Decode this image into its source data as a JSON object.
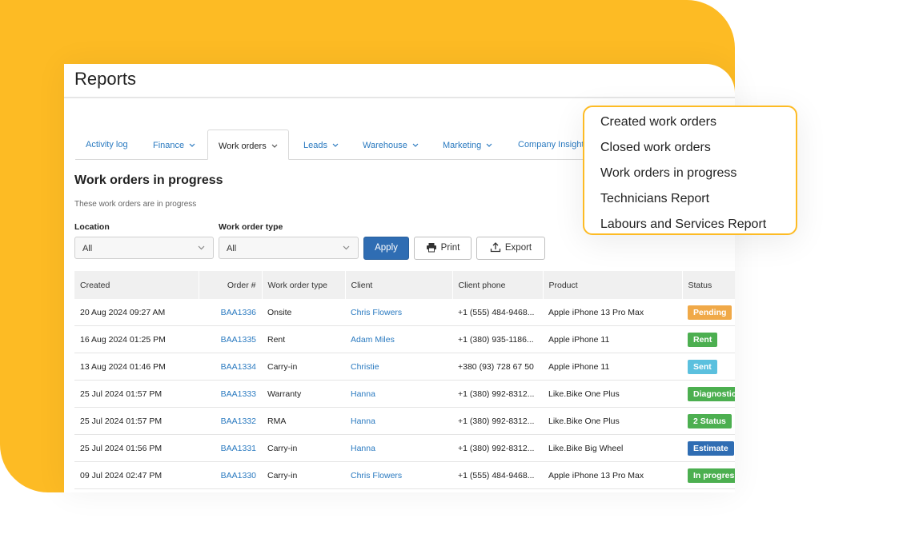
{
  "page": {
    "title": "Reports"
  },
  "tabs": [
    {
      "label": "Activity log",
      "has_chevron": false
    },
    {
      "label": "Finance",
      "has_chevron": true
    },
    {
      "label": "Work orders",
      "has_chevron": true,
      "active": true
    },
    {
      "label": "Leads",
      "has_chevron": true
    },
    {
      "label": "Warehouse",
      "has_chevron": true
    },
    {
      "label": "Marketing",
      "has_chevron": true
    },
    {
      "label": "Company Insight",
      "has_chevron": false
    }
  ],
  "section": {
    "title": "Work orders in progress",
    "subtitle": "These work orders are in progress"
  },
  "filters": {
    "location": {
      "label": "Location",
      "value": "All"
    },
    "type": {
      "label": "Work order type",
      "value": "All"
    }
  },
  "buttons": {
    "apply": "Apply",
    "print": "Print",
    "export": "Export"
  },
  "table": {
    "headers": [
      "Created",
      "Order #",
      "Work order type",
      "Client",
      "Client phone",
      "Product",
      "Status"
    ],
    "rows": [
      {
        "created": "20 Aug 2024 09:27 AM",
        "order": "BAA1336",
        "type": "Onsite",
        "client": "Chris Flowers",
        "phone": "+1 (555) 484-9468...",
        "product": "Apple iPhone 13 Pro Max",
        "status": "Pending",
        "status_color": "#f0a948"
      },
      {
        "created": "16 Aug 2024 01:25 PM",
        "order": "BAA1335",
        "type": "Rent",
        "client": "Adam Miles",
        "phone": "+1 (380) 935-1186...",
        "product": "Apple iPhone 11",
        "status": "Rent",
        "status_color": "#4caf50"
      },
      {
        "created": "13 Aug 2024 01:46 PM",
        "order": "BAA1334",
        "type": "Carry-in",
        "client": "Christie",
        "phone": "+380 (93) 728 67 50",
        "product": "Apple iPhone 11",
        "status": "Sent",
        "status_color": "#5bc0de"
      },
      {
        "created": "25 Jul 2024 01:57 PM",
        "order": "BAA1333",
        "type": "Warranty",
        "client": "Hanna",
        "phone": "+1 (380) 992-8312...",
        "product": "Like.Bike One Plus",
        "status": "Diagnostic",
        "status_color": "#4caf50"
      },
      {
        "created": "25 Jul 2024 01:57 PM",
        "order": "BAA1332",
        "type": "RMA",
        "client": "Hanna",
        "phone": "+1 (380) 992-8312...",
        "product": "Like.Bike One Plus",
        "status": "2 Status",
        "status_color": "#4caf50"
      },
      {
        "created": "25 Jul 2024 01:56 PM",
        "order": "BAA1331",
        "type": "Carry-in",
        "client": "Hanna",
        "phone": "+1 (380) 992-8312...",
        "product": "Like.Bike Big Wheel",
        "status": "Estimate",
        "status_color": "#2f6db3"
      },
      {
        "created": "09 Jul 2024 02:47 PM",
        "order": "BAA1330",
        "type": "Carry-in",
        "client": "Chris Flowers",
        "phone": "+1 (555) 484-9468...",
        "product": "Apple iPhone 13 Pro Max",
        "status": "In progress",
        "status_color": "#4caf50"
      }
    ]
  },
  "dropdown": {
    "items": [
      "Created work orders",
      "Closed work orders",
      "Work orders in progress",
      "Technicians Report",
      "Labours and Services Report"
    ]
  }
}
